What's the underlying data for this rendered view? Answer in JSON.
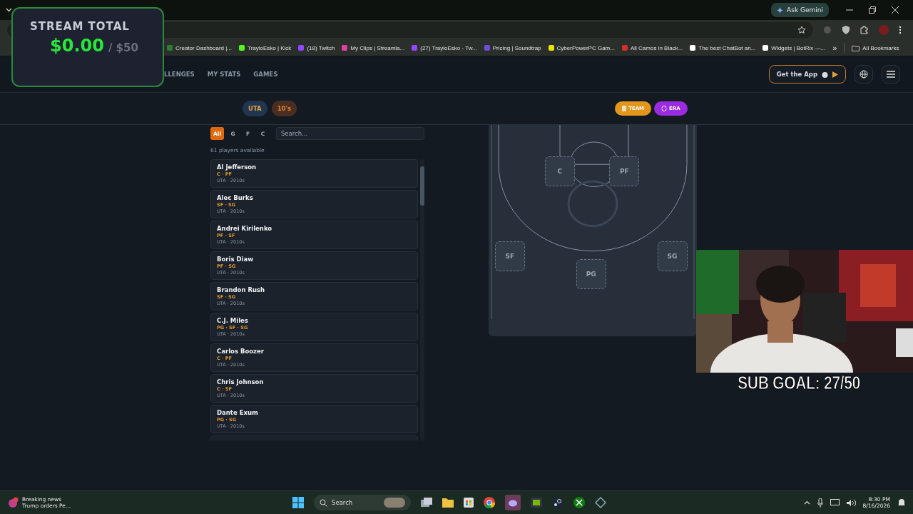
{
  "browser": {
    "ask_button": "Ask Gemini",
    "bookmarks": [
      {
        "label": "Creator Dashboard |...",
        "color": "#2e7d32"
      },
      {
        "label": "TrayloEsko | Kick",
        "color": "#53fc18"
      },
      {
        "label": "(18) Twitch",
        "color": "#9146ff"
      },
      {
        "label": "My Clips | Streamla...",
        "color": "#e040a0"
      },
      {
        "label": "(27) TrayloEsko - Tw...",
        "color": "#9146ff"
      },
      {
        "label": "Pricing | Soundtrap",
        "color": "#6b4fd8"
      },
      {
        "label": "CyberPowerPC Gam...",
        "color": "#e6e600"
      },
      {
        "label": "All Camos in Black...",
        "color": "#d32f2f"
      },
      {
        "label": "The best ChatBot an...",
        "color": "#ffffff"
      },
      {
        "label": "Widgets | BotRix —...",
        "color": "#ffffff"
      }
    ],
    "more": "»",
    "all_bookmarks": "All Bookmarks"
  },
  "site": {
    "nav": [
      {
        "label": "LLENGES"
      },
      {
        "label": "MY STATS"
      },
      {
        "label": "GAMES"
      }
    ],
    "app_button": "Get the App"
  },
  "filters": {
    "team": "UTA",
    "era": "10's"
  },
  "actions": [
    {
      "label": "TEAM",
      "kind": "team"
    },
    {
      "label": "ERA",
      "kind": "era"
    }
  ],
  "positions": [
    {
      "label": "All",
      "selected": true
    },
    {
      "label": "G",
      "selected": false
    },
    {
      "label": "F",
      "selected": false
    },
    {
      "label": "C",
      "selected": false
    }
  ],
  "search": {
    "placeholder": "Search..."
  },
  "count": "61 players available",
  "players": [
    {
      "name": "Al Jefferson",
      "positions": "C · PF",
      "meta": "UTA · 2010s"
    },
    {
      "name": "Alec Burks",
      "positions": "SF · SG",
      "meta": "UTA · 2010s"
    },
    {
      "name": "Andrei Kirilenko",
      "positions": "PF · SF",
      "meta": "UTA · 2010s"
    },
    {
      "name": "Boris Diaw",
      "positions": "PF · SG",
      "meta": "UTA · 2010s"
    },
    {
      "name": "Brandon Rush",
      "positions": "SF · SG",
      "meta": "UTA · 2010s"
    },
    {
      "name": "C.J. Miles",
      "positions": "PG · SF · SG",
      "meta": "UTA · 2010s"
    },
    {
      "name": "Carlos Boozer",
      "positions": "C · PF",
      "meta": "UTA · 2010s"
    },
    {
      "name": "Chris Johnson",
      "positions": "C · SF",
      "meta": "UTA · 2010s"
    },
    {
      "name": "Dante Exum",
      "positions": "PG · SG",
      "meta": "UTA · 2010s"
    }
  ],
  "court": {
    "slots": [
      {
        "label": "C"
      },
      {
        "label": "PF"
      },
      {
        "label": "SF"
      },
      {
        "label": "SG"
      },
      {
        "label": "PG"
      }
    ]
  },
  "overlay": {
    "title": "STREAM TOTAL",
    "amount": "$0.00",
    "goal": "/ $50"
  },
  "sub_goal": "SUB GOAL: 27/50",
  "taskbar": {
    "news_title": "Breaking news",
    "news_text": "Trump orders Pe...",
    "search": "Search",
    "time": "8:30 PM",
    "date": "8/16/2026"
  }
}
